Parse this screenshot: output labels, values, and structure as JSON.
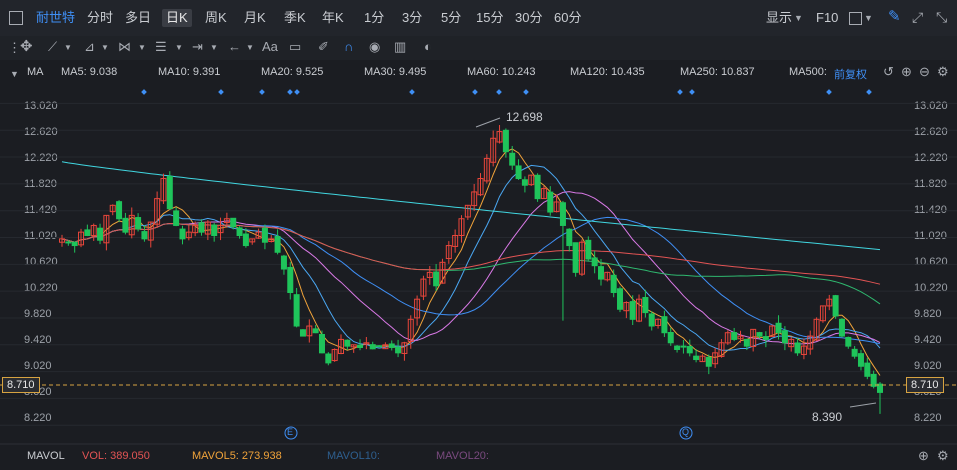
{
  "toolbar": {
    "stock_name": "耐世特",
    "periods": [
      "分时",
      "多日",
      "日K",
      "周K",
      "月K",
      "季K",
      "年K",
      "1分",
      "3分",
      "5分",
      "15分",
      "30分",
      "60分"
    ],
    "active_period": "日K",
    "display_label": "显示",
    "f10_label": "F10",
    "ma_label": "MA",
    "adjust_label": "前复权",
    "text_tool_label": "Aa"
  },
  "colors": {
    "up": "#e9463b",
    "down": "#1fc45b",
    "ma5": "#f0a33a",
    "ma10": "#4aa7f2",
    "ma20": "#d979e6",
    "ma30": "#3f8ff5",
    "ma60": "#2fb86f",
    "ma120": "#e25454",
    "ma250": "#41d6e0",
    "ma500": "#a8862e",
    "crosshair": "#d7a341"
  },
  "ma_values": [
    {
      "label": "MA5:",
      "value": "9.038",
      "color": "#f0a33a"
    },
    {
      "label": "MA10:",
      "value": "9.391",
      "color": "#4aa7f2"
    },
    {
      "label": "MA20:",
      "value": "9.525",
      "color": "#d979e6"
    },
    {
      "label": "MA30:",
      "value": "9.495",
      "color": "#3f8ff5"
    },
    {
      "label": "MA60:",
      "value": "10.243",
      "color": "#2fb86f"
    },
    {
      "label": "MA120:",
      "value": "10.435",
      "color": "#e25454"
    },
    {
      "label": "MA250:",
      "value": "10.837",
      "color": "#41d6e0"
    },
    {
      "label": "MA500:",
      "value": "",
      "color": "#a8862e"
    }
  ],
  "price_axis_labels": [
    "13.020",
    "12.620",
    "12.220",
    "11.820",
    "11.420",
    "11.020",
    "10.620",
    "10.220",
    "9.820",
    "9.420",
    "9.020",
    "8.620",
    "8.220"
  ],
  "current_price": "8.710",
  "max_label": "12.698",
  "min_label": "8.390",
  "event_markers": [
    "E",
    "Q"
  ],
  "volume_bar": {
    "name": "MAVOL",
    "vol_label": "VOL: 389.050",
    "mavol5_label": "MAVOL5: 273.938",
    "mavol10_label": "MAVOL10:",
    "mavol20_label": "MAVOL20:"
  },
  "chart_data": {
    "type": "candlestick",
    "ylim": [
      8.0,
      13.25
    ],
    "grid": true,
    "closes": [
      11.0,
      10.95,
      10.9,
      11.1,
      11.05,
      11.2,
      10.98,
      11.35,
      11.5,
      11.3,
      11.1,
      11.35,
      11.15,
      11.0,
      11.25,
      11.6,
      11.9,
      11.45,
      11.2,
      11.0,
      11.1,
      11.2,
      11.1,
      11.25,
      11.05,
      11.2,
      11.3,
      11.18,
      11.05,
      10.9,
      11.0,
      11.1,
      10.95,
      11.0,
      10.8,
      10.55,
      10.2,
      9.7,
      9.55,
      9.7,
      9.6,
      9.3,
      9.15,
      9.35,
      9.5,
      9.4,
      9.42,
      9.38,
      9.45,
      9.36,
      9.4,
      9.42,
      9.38,
      9.3,
      9.45,
      9.8,
      10.1,
      10.4,
      10.5,
      10.3,
      10.65,
      10.9,
      11.05,
      11.3,
      11.5,
      11.7,
      11.9,
      12.2,
      12.5,
      12.6,
      12.3,
      12.1,
      11.9,
      11.8,
      11.95,
      11.6,
      11.75,
      11.4,
      11.55,
      11.2,
      10.9,
      10.5,
      10.95,
      10.7,
      10.6,
      10.4,
      10.5,
      10.2,
      9.95,
      10.05,
      9.8,
      10.1,
      9.9,
      9.7,
      9.8,
      9.6,
      9.45,
      9.35,
      9.4,
      9.3,
      9.2,
      9.25,
      9.1,
      9.3,
      9.45,
      9.6,
      9.5,
      9.55,
      9.4,
      9.65,
      9.55,
      9.5,
      9.7,
      9.6,
      9.45,
      9.5,
      9.3,
      9.4,
      9.55,
      9.8,
      10.0,
      10.1,
      9.85,
      9.55,
      9.4,
      9.25,
      9.1,
      8.95,
      8.8,
      8.71
    ],
    "max_price": 12.698,
    "min_price": 8.39,
    "ma_series": [
      "MA5",
      "MA10",
      "MA20",
      "MA30",
      "MA60",
      "MA120",
      "MA250"
    ]
  }
}
